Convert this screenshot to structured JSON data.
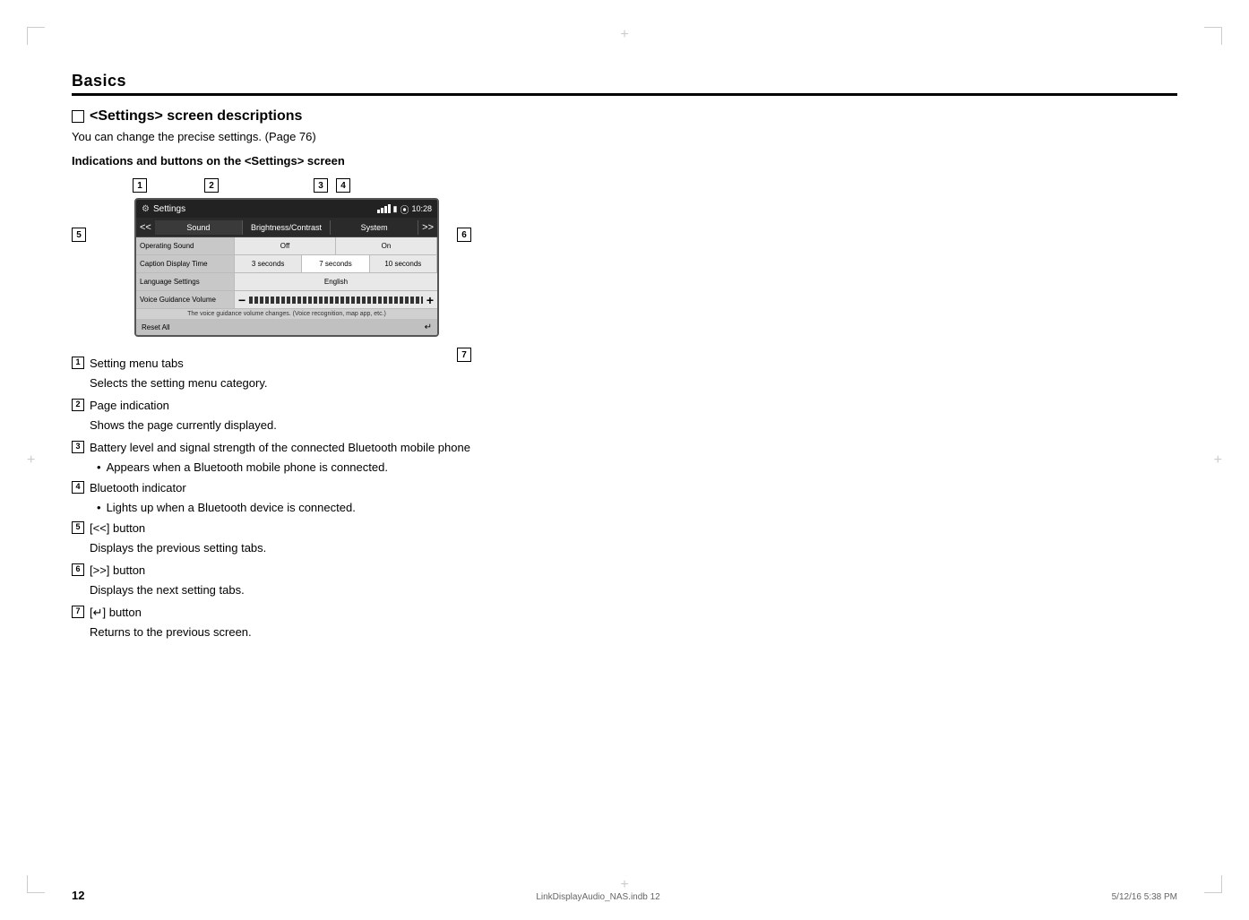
{
  "page": {
    "number": "12",
    "filename": "LinkDisplayAudio_NAS.indb   12",
    "date": "5/12/16   5:38 PM"
  },
  "section": {
    "title": "Basics"
  },
  "subsection": {
    "title": "<Settings> screen descriptions",
    "subtitle": "You can change the precise settings. (Page 76)",
    "indications_title": "Indications and buttons on the <Settings> screen"
  },
  "screen": {
    "status": {
      "label": "Settings",
      "time": "10:28"
    },
    "tabs": [
      "Sound",
      "Brightness/Contrast",
      "System"
    ],
    "rows": [
      {
        "label": "Operating Sound",
        "values": [
          "Off",
          "On"
        ]
      },
      {
        "label": "Caption Display Time",
        "values": [
          "3 seconds",
          "7 seconds",
          "10 seconds"
        ]
      },
      {
        "label": "Language Settings",
        "value": "English"
      },
      {
        "label": "Voice Guidance Volume",
        "controls": true
      }
    ],
    "hint": "The voice guidance volume changes. (Voice recognition, map app, etc.)",
    "reset_label": "Reset All"
  },
  "num_labels": {
    "1": "1",
    "2": "2",
    "3": "3",
    "4": "4",
    "5": "5",
    "6": "6",
    "7": "7"
  },
  "list_items": [
    {
      "num": "1",
      "title": "Setting menu tabs",
      "desc": "Selects the setting menu category."
    },
    {
      "num": "2",
      "title": "Page indication",
      "desc": "Shows the page currently displayed."
    },
    {
      "num": "3",
      "title": "Battery level and signal strength of the connected Bluetooth mobile phone",
      "bullets": [
        "Appears when a Bluetooth mobile phone is connected."
      ]
    },
    {
      "num": "4",
      "title": "Bluetooth indicator",
      "bullets": [
        "Lights up when a Bluetooth device is connected."
      ]
    },
    {
      "num": "5",
      "title": "[<<] button",
      "desc": "Displays the previous setting tabs."
    },
    {
      "num": "6",
      "title": "[>>] button",
      "desc": "Displays the next setting tabs."
    },
    {
      "num": "7",
      "title": "[↵] button",
      "desc": "Returns to the previous screen."
    }
  ]
}
